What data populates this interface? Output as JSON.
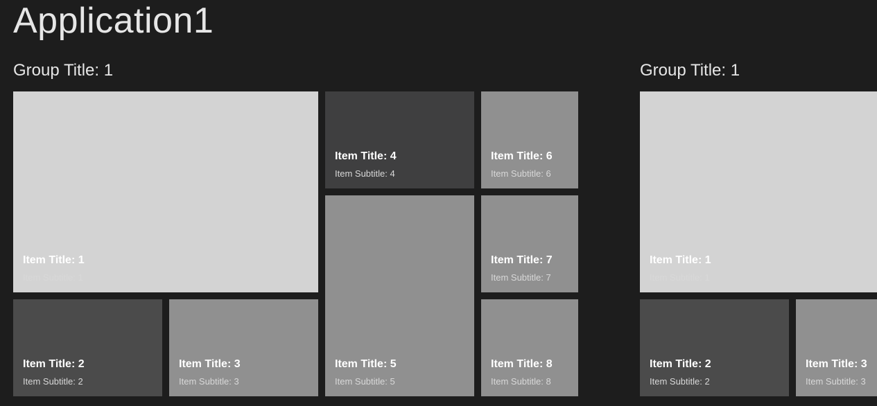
{
  "app_title": "Application1",
  "groups": [
    {
      "title": "Group Title: 1",
      "items": [
        {
          "title": "Item Title: 1",
          "subtitle": "Item Subtitle: 1"
        },
        {
          "title": "Item Title: 2",
          "subtitle": "Item Subtitle: 2"
        },
        {
          "title": "Item Title: 3",
          "subtitle": "Item Subtitle: 3"
        },
        {
          "title": "Item Title: 4",
          "subtitle": "Item Subtitle: 4"
        },
        {
          "title": "Item Title: 5",
          "subtitle": "Item Subtitle: 5"
        },
        {
          "title": "Item Title: 6",
          "subtitle": "Item Subtitle: 6"
        },
        {
          "title": "Item Title: 7",
          "subtitle": "Item Subtitle: 7"
        },
        {
          "title": "Item Title: 8",
          "subtitle": "Item Subtitle: 8"
        }
      ]
    },
    {
      "title": "Group Title: 1",
      "items": [
        {
          "title": "Item Title: 1",
          "subtitle": "Item Subtitle: 1"
        },
        {
          "title": "Item Title: 2",
          "subtitle": "Item Subtitle: 2"
        },
        {
          "title": "Item Title: 3",
          "subtitle": "Item Subtitle: 3"
        }
      ]
    }
  ]
}
